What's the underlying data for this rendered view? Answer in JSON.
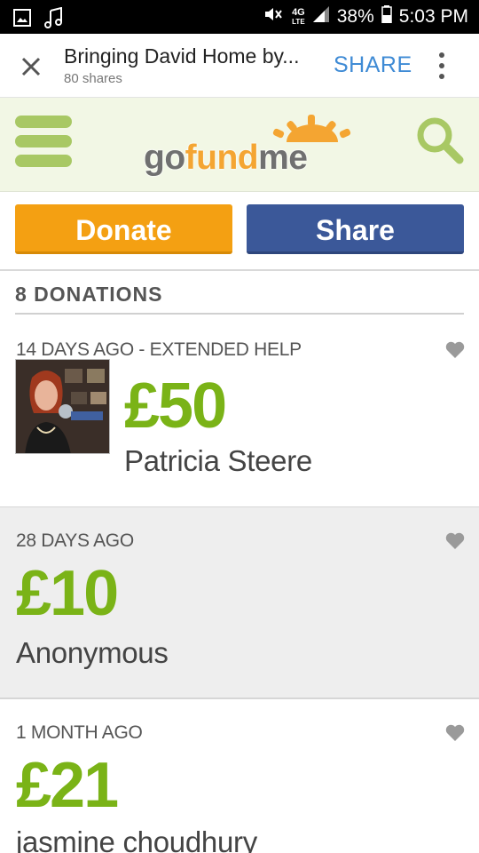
{
  "status_bar": {
    "network": "4G",
    "network_sub": "LTE",
    "battery": "38%",
    "time": "5:03 PM"
  },
  "header": {
    "title": "Bringing David Home by...",
    "subtitle": "80 shares",
    "share_label": "SHARE"
  },
  "nav": {
    "logo_part1": "go",
    "logo_part2": "fund",
    "logo_part3": "me"
  },
  "actions": {
    "donate_label": "Donate",
    "share_label": "Share"
  },
  "donations": {
    "title": "8 DONATIONS",
    "items": [
      {
        "time": "14 DAYS AGO - EXTENDED HELP",
        "amount": "£50",
        "name": "Patricia Steere"
      },
      {
        "time": "28 DAYS AGO",
        "amount": "£10",
        "name": "Anonymous"
      },
      {
        "time": "1 MONTH AGO",
        "amount": "£21",
        "name": "jasmine choudhury"
      }
    ]
  },
  "colors": {
    "accent_green": "#7ab317",
    "donate_orange": "#f4a012",
    "share_blue": "#3b5899",
    "link_blue": "#3f8bd5"
  },
  "icons": [
    "image-icon",
    "music-icon",
    "mute-icon",
    "signal-icon",
    "battery-icon",
    "close-icon",
    "more-vert-icon",
    "hamburger-icon",
    "search-icon",
    "heart-icon"
  ]
}
